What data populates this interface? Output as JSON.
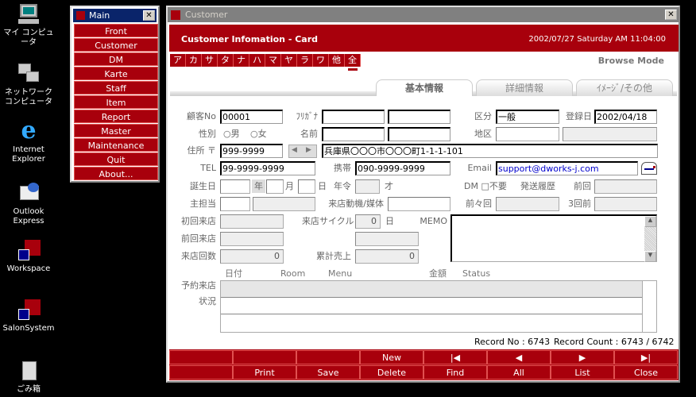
{
  "desktop": {
    "icons": [
      {
        "label": "マイ コンピュータ",
        "icon": "my-computer-icon"
      },
      {
        "label": "ネットワーク コンピュータ",
        "icon": "network-icon"
      },
      {
        "label": "Internet Explorer",
        "icon": "internet-explorer-icon"
      },
      {
        "label": "Outlook Express",
        "icon": "outlook-express-icon"
      },
      {
        "label": "Workspace",
        "icon": "workspace-shortcut-icon"
      },
      {
        "label": "SalonSystem",
        "icon": "salonsystem-shortcut-icon"
      },
      {
        "label": "ごみ箱",
        "icon": "recycle-bin-icon"
      }
    ]
  },
  "main_menu": {
    "title": "Main",
    "items": [
      "Front",
      "Customer",
      "DM",
      "Karte",
      "Staff",
      "Item",
      "Report",
      "Master",
      "Maintenance",
      "Quit",
      "About..."
    ]
  },
  "customer": {
    "window_title": "Customer",
    "header_title": "Customer Infomation - Card",
    "datetime": "2002/07/27 Saturday AM 11:04:00",
    "kana": [
      "ア",
      "カ",
      "サ",
      "タ",
      "ナ",
      "ハ",
      "マ",
      "ヤ",
      "ラ",
      "ワ",
      "他",
      "全"
    ],
    "kana_selected": "全",
    "mode": "Browse Mode",
    "tabs": [
      "基本情報",
      "詳細情報",
      "ｲﾒｰｼﾞ/その他"
    ],
    "active_tab": "基本情報",
    "labels": {
      "customer_no": "顧客No",
      "furigana": "ﾌﾘｶﾞﾅ",
      "category": "区分",
      "registered": "登録日",
      "gender": "性別",
      "male": "○男",
      "female": "○女",
      "name": "名前",
      "area": "地区",
      "address": "住所 〒",
      "tel": "TEL",
      "mobile": "携帯",
      "email": "Email",
      "birthday": "誕生日",
      "year": "年",
      "month": "月",
      "day": "日",
      "age": "年令",
      "age_unit": "才",
      "dm": "DM □不要",
      "send_history": "発送履歴",
      "last": "前回",
      "before_last": "前々回",
      "three_before": "3回前",
      "staff": "主担当",
      "motive": "来店動機/媒体",
      "first_visit": "初回来店",
      "cycle": "来店サイクル",
      "cycle_unit": "日",
      "memo": "MEMO",
      "last_visit": "前回来店",
      "visit_count": "来店回数",
      "total_sales": "累計売上",
      "reservation": "予約来店",
      "status_label": "状況"
    },
    "values": {
      "customer_no": "00001",
      "category": "一般",
      "registered": "2002/04/18",
      "zip": "999-9999",
      "address": "兵庫県〇〇〇市〇〇〇町1-1-1-101",
      "tel": "99-9999-9999",
      "mobile": "090-9999-9999",
      "email": "support@dworks-j.com",
      "cycle": "0",
      "visit_count": "0",
      "total_sales": "0"
    },
    "table_headers": [
      "日付",
      "Room",
      "Menu",
      "金額",
      "Status"
    ],
    "record_no": "Record No : 6743",
    "record_count": "Record Count : 6743 / 6742",
    "footer_row1": [
      "",
      "",
      "",
      "New",
      "|◀",
      "◀",
      "▶",
      "▶|"
    ],
    "footer_row2": [
      "",
      "Print",
      "Save",
      "Delete",
      "Find",
      "All",
      "List",
      "Close"
    ]
  },
  "colors": {
    "brand_red": "#a8000c",
    "title_navy": "#0a246a",
    "email_blue": "#0000cc"
  }
}
